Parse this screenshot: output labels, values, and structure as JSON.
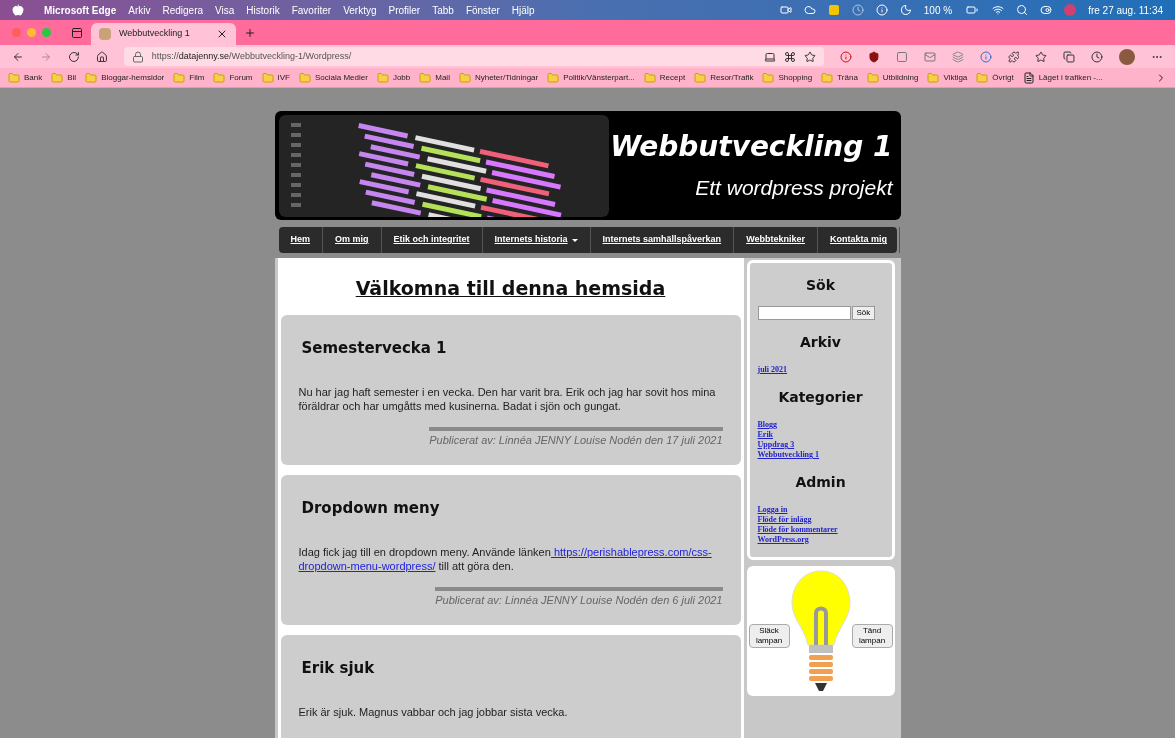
{
  "menu_bar": {
    "app": "Microsoft Edge",
    "menus": [
      "Arkiv",
      "Redigera",
      "Visa",
      "Historik",
      "Favoriter",
      "Verktyg",
      "Profiler",
      "Tabb",
      "Fönster",
      "Hjälp"
    ],
    "battery": "100 %",
    "clock": "fre 27 aug. 11:34"
  },
  "browser": {
    "tabs": [
      {
        "title": "Webbutveckling 1",
        "selected": true
      }
    ],
    "url": {
      "scheme": "https://",
      "host": "datajenny.se",
      "path": "/Webbutveckling-1/Wordpress/"
    },
    "bookmarks": [
      {
        "label": "Bank",
        "kind": "folder"
      },
      {
        "label": "Bil",
        "kind": "folder"
      },
      {
        "label": "Bloggar-hemsidor",
        "kind": "folder"
      },
      {
        "label": "Film",
        "kind": "folder"
      },
      {
        "label": "Forum",
        "kind": "folder"
      },
      {
        "label": "IVF",
        "kind": "folder"
      },
      {
        "label": "Sociala Medier",
        "kind": "folder"
      },
      {
        "label": "Jobb",
        "kind": "folder"
      },
      {
        "label": "Mail",
        "kind": "folder"
      },
      {
        "label": "Nyheter/Tidningar",
        "kind": "folder"
      },
      {
        "label": "Politik/Vänsterpart...",
        "kind": "folder"
      },
      {
        "label": "Recept",
        "kind": "folder"
      },
      {
        "label": "Resor/Trafik",
        "kind": "folder"
      },
      {
        "label": "Shopping",
        "kind": "folder"
      },
      {
        "label": "Träna",
        "kind": "folder"
      },
      {
        "label": "Utbildning",
        "kind": "folder"
      },
      {
        "label": "Viktiga",
        "kind": "folder"
      },
      {
        "label": "Övrigt",
        "kind": "folder"
      },
      {
        "label": "Läget i trafiken -...",
        "kind": "page"
      }
    ]
  },
  "site": {
    "title": "Webbutveckling 1",
    "tagline": "Ett wordpress projekt",
    "nav": [
      {
        "label": "Hem",
        "dropdown": false
      },
      {
        "label": "Om mig",
        "dropdown": false
      },
      {
        "label": "Etik och integritet",
        "dropdown": false
      },
      {
        "label": "Internets historia",
        "dropdown": true
      },
      {
        "label": "Internets samhällspåverkan",
        "dropdown": false
      },
      {
        "label": "Webbtekniker",
        "dropdown": false
      },
      {
        "label": "Kontakta mig",
        "dropdown": false
      }
    ],
    "welcome": "Välkomna till denna hemsida",
    "posts": [
      {
        "title": "Semestervecka 1",
        "body": [
          {
            "kind": "text",
            "text": "Nu har jag haft semester i en vecka. Den har varit bra. Erik och jag har sovit hos mina föräldrar och har umgåtts med kusinerna. Badat i sjön och gungat."
          }
        ],
        "byline": "Publicerat av: Linnéa JENNY Louise Nodén den 17 juli 2021"
      },
      {
        "title": "Dropdown meny",
        "body": [
          {
            "kind": "text",
            "text": "Idag fick jag till en dropdown meny. Använde länken"
          },
          {
            "kind": "link",
            "text": " https://perishablepress.com/css-"
          },
          {
            "kind": "link",
            "text": "dropdown-menu-wordpress/"
          },
          {
            "kind": "text",
            "text": " till att göra den."
          }
        ],
        "byline": "Publicerat av: Linnéa JENNY Louise Nodén den 6 juli 2021"
      },
      {
        "title": "Erik sjuk",
        "body": [
          {
            "kind": "text",
            "text": "Erik är sjuk. Magnus vabbar och jag jobbar sista vecka."
          }
        ]
      }
    ],
    "sidebar": {
      "search_heading": "Sök",
      "search_button": "Sök",
      "sections": [
        {
          "heading": "Arkiv",
          "links": [
            "juli 2021"
          ]
        },
        {
          "heading": "Kategorier",
          "links": [
            "Blogg",
            "Erik",
            "Uppdrag 3",
            "Webbutveckling 1"
          ]
        },
        {
          "heading": "Admin",
          "links": [
            "Logga in",
            "Flöde för inlägg",
            "Flöde för kommentarer",
            "WordPress.org"
          ]
        }
      ],
      "lamp": {
        "off_button": "Släck lampan",
        "on_button": "Tänd lampan",
        "on": true
      }
    }
  }
}
